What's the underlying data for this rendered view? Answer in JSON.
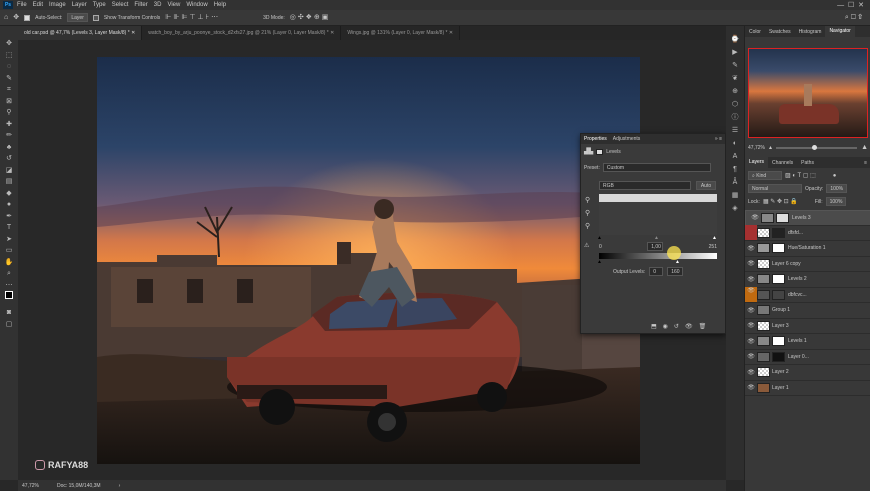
{
  "menubar": {
    "logo": "Ps",
    "items": [
      "File",
      "Edit",
      "Image",
      "Layer",
      "Type",
      "Select",
      "Filter",
      "3D",
      "View",
      "Window",
      "Help"
    ]
  },
  "options": {
    "auto_select": "Auto-Select:",
    "auto_select_target": "Layer",
    "show_transform": "Show Transform Controls",
    "mode_3d": "3D Mode:"
  },
  "tabs": [
    {
      "label": "old car.psd @ 47,7% (Levels 3, Layer Mask/8) *",
      "active": true
    },
    {
      "label": "watch_boy_by_arju_poonye_stock_d2xfs27.jpg @ 21% (Layer 0, Layer Mask/8) *",
      "active": false
    },
    {
      "label": "Wings.jpg @ 131% (Layer 0, Layer Mask/8) *",
      "active": false
    }
  ],
  "status": {
    "zoom": "47,72%",
    "doc": "Doc: 15,0M/140,3M"
  },
  "watermark": "RAFYA88",
  "properties": {
    "tabs": [
      "Properties",
      "Adjustments"
    ],
    "title": "Levels",
    "preset_label": "Preset:",
    "preset_value": "Custom",
    "channel": "RGB",
    "auto": "Auto",
    "input_black": "0",
    "input_gamma": "1,00",
    "input_white": "251",
    "output_label": "Output Levels:",
    "output_black": "0",
    "output_white": "160"
  },
  "navigator": {
    "tabs": [
      "Color",
      "Swatches",
      "Histogram",
      "Navigator"
    ],
    "active": "Navigator",
    "zoom": "47,72%"
  },
  "layers_panel": {
    "tabs": [
      "Layers",
      "Channels",
      "Paths"
    ],
    "kind": "Kind",
    "blend": "Normal",
    "opacity_label": "Opacity:",
    "opacity": "100%",
    "lock_label": "Lock:",
    "fill_label": "Fill:",
    "fill": "100%",
    "layers": [
      {
        "name": "Levels 3",
        "selected": true,
        "eye": "👁",
        "thumb": "#888",
        "mask": "#ddd"
      },
      {
        "name": "dfsfd...",
        "selected": false,
        "eye": "",
        "thumb": "checker",
        "mask": "#222"
      },
      {
        "name": "Hue/Saturation 1",
        "selected": false,
        "eye": "👁",
        "thumb": "#999",
        "mask": "#fff"
      },
      {
        "name": "Layer 6 copy",
        "selected": false,
        "eye": "👁",
        "thumb": "checker",
        "mask": ""
      },
      {
        "name": "Levels 2",
        "selected": false,
        "eye": "👁",
        "thumb": "#888",
        "mask": "#fff"
      },
      {
        "name": "dbfcvc...",
        "selected": false,
        "eye": "👁",
        "thumb": "#555",
        "mask": "#444"
      },
      {
        "name": "Group 1",
        "selected": false,
        "eye": "👁",
        "thumb": "#777",
        "mask": ""
      },
      {
        "name": "Layer 3",
        "selected": false,
        "eye": "👁",
        "thumb": "checker",
        "mask": ""
      },
      {
        "name": "Levels 1",
        "selected": false,
        "eye": "👁",
        "thumb": "#888",
        "mask": "#fff"
      },
      {
        "name": "Layer 0...",
        "selected": false,
        "eye": "👁",
        "thumb": "#666",
        "mask": "#111"
      },
      {
        "name": "Layer 2",
        "selected": false,
        "eye": "👁",
        "thumb": "checker",
        "mask": ""
      },
      {
        "name": "Layer 1",
        "selected": false,
        "eye": "👁",
        "thumb": "#8a5a3a",
        "mask": ""
      }
    ]
  }
}
